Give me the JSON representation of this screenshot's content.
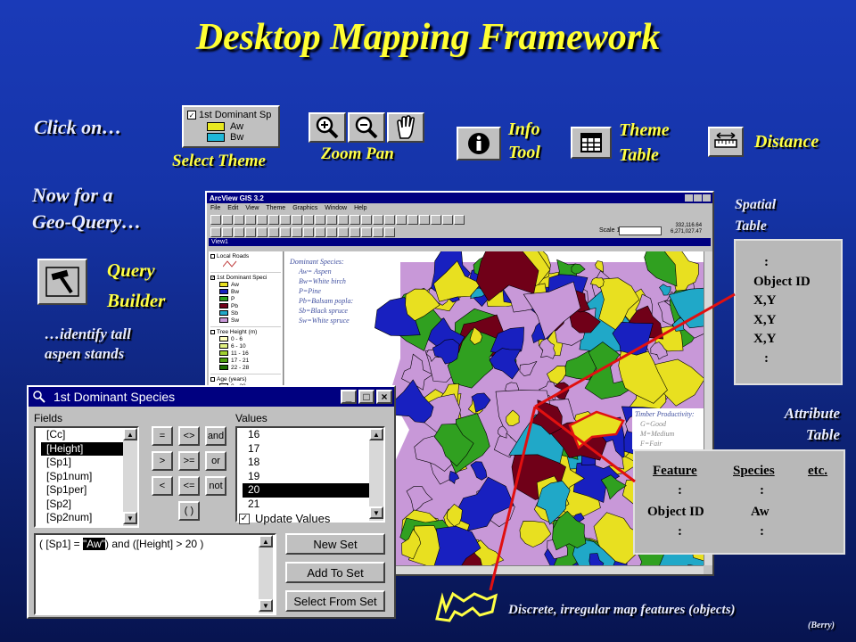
{
  "title": "Desktop Mapping Framework",
  "labels": {
    "click_on": "Click on…",
    "select_theme": "Select Theme",
    "zoom_pan": "Zoom Pan",
    "info": "Info",
    "tool": "Tool",
    "theme": "Theme",
    "table": "Table",
    "distance": "Distance",
    "now_for_a": "Now for a",
    "geo_query": "Geo-Query…",
    "query": "Query",
    "builder": "Builder",
    "identify": "…identify tall",
    "aspen": "aspen stands",
    "spatial": "Spatial",
    "spatial_table": "Table",
    "attribute": "Attribute",
    "attribute_table": "Table",
    "discrete": "Discrete, irregular map features (objects)",
    "berry": "(Berry)"
  },
  "legend_swatch": {
    "title": "1st Dominant Sp",
    "items": [
      {
        "label": "Aw",
        "color": "#e8e820"
      },
      {
        "label": "Bw",
        "color": "#20b8d8"
      }
    ]
  },
  "spatial_table": {
    "rows": [
      ":",
      "Object ID",
      "X,Y",
      "X,Y",
      "X,Y",
      ":"
    ]
  },
  "attribute_table": {
    "headers": [
      "Feature",
      "Species",
      "etc."
    ],
    "rows": [
      [
        ":",
        ":"
      ],
      [
        "Object ID",
        "Aw"
      ],
      [
        ":",
        ":"
      ]
    ]
  },
  "arcview": {
    "title": "ArcView GIS 3.2",
    "menus": [
      "File",
      "Edit",
      "View",
      "Theme",
      "Graphics",
      "Window",
      "Help"
    ],
    "scale_label": "Scale 1:",
    "coords": [
      "332,116.64",
      "6,271,027.47"
    ],
    "view_title": "View1",
    "toc": [
      {
        "label": "Local Roads"
      },
      {
        "label": "1st Dominant Speci"
      },
      {
        "label": "Tree Height (m)"
      },
      {
        "label": "Age (years)"
      }
    ],
    "toc_species": [
      {
        "label": "Aw",
        "color": "#e8e020"
      },
      {
        "label": "Bw",
        "color": "#1820c0"
      },
      {
        "label": "P",
        "color": "#30a020"
      },
      {
        "label": "Pb",
        "color": "#700018"
      },
      {
        "label": "Sb",
        "color": "#20a8c8"
      },
      {
        "label": "Sw",
        "color": "#c898d8"
      }
    ],
    "toc_height": [
      {
        "label": "0 - 6",
        "color": "#ffffc0"
      },
      {
        "label": "6 - 10",
        "color": "#e0f080"
      },
      {
        "label": "11 - 16",
        "color": "#a0d030"
      },
      {
        "label": "17 - 21",
        "color": "#50a010"
      },
      {
        "label": "22 - 28",
        "color": "#207000"
      }
    ],
    "toc_age": [
      {
        "label": "0 - 28"
      }
    ],
    "species_note": {
      "title": "Dominant Species:",
      "lines": [
        "Aw= Aspen",
        "Bw=White birch",
        "P=Pine",
        "Pb=Balsam popla:",
        "Sb=Black spruce",
        "Sw=White spruce"
      ]
    },
    "timber_note": {
      "title": "Timber Productivity:",
      "lines": [
        "G=Good",
        "M=Medium",
        "F=Fair"
      ]
    }
  },
  "query_dialog": {
    "title": "1st Dominant Species",
    "fields_label": "Fields",
    "values_label": "Values",
    "fields": [
      "[Cc]",
      "[Height]",
      "[Sp1]",
      "[Sp1num]",
      "[Sp1per]",
      "[Sp2]",
      "[Sp2num]"
    ],
    "selected_field": 1,
    "values": [
      "16",
      "17",
      "18",
      "19",
      "20",
      "21"
    ],
    "selected_value": 4,
    "operators": [
      "=",
      "<>",
      "and",
      ">",
      ">=",
      "or",
      "<",
      "<=",
      "not",
      "( )"
    ],
    "update_values": "Update Values",
    "expression_prefix": "( [Sp1] = ",
    "expression_highlight": "\"Aw\"",
    "expression_suffix": ") and ([Height] > 20 )",
    "buttons": [
      "New Set",
      "Add To Set",
      "Select From Set"
    ]
  },
  "colors": {
    "title": "#ffff33",
    "accent_red": "#e01010",
    "aspen": "#e8e020",
    "birch": "#1820c0",
    "pine": "#30a020",
    "balsam": "#700018",
    "black_spruce": "#20a8c8",
    "white_spruce": "#c898d8"
  }
}
